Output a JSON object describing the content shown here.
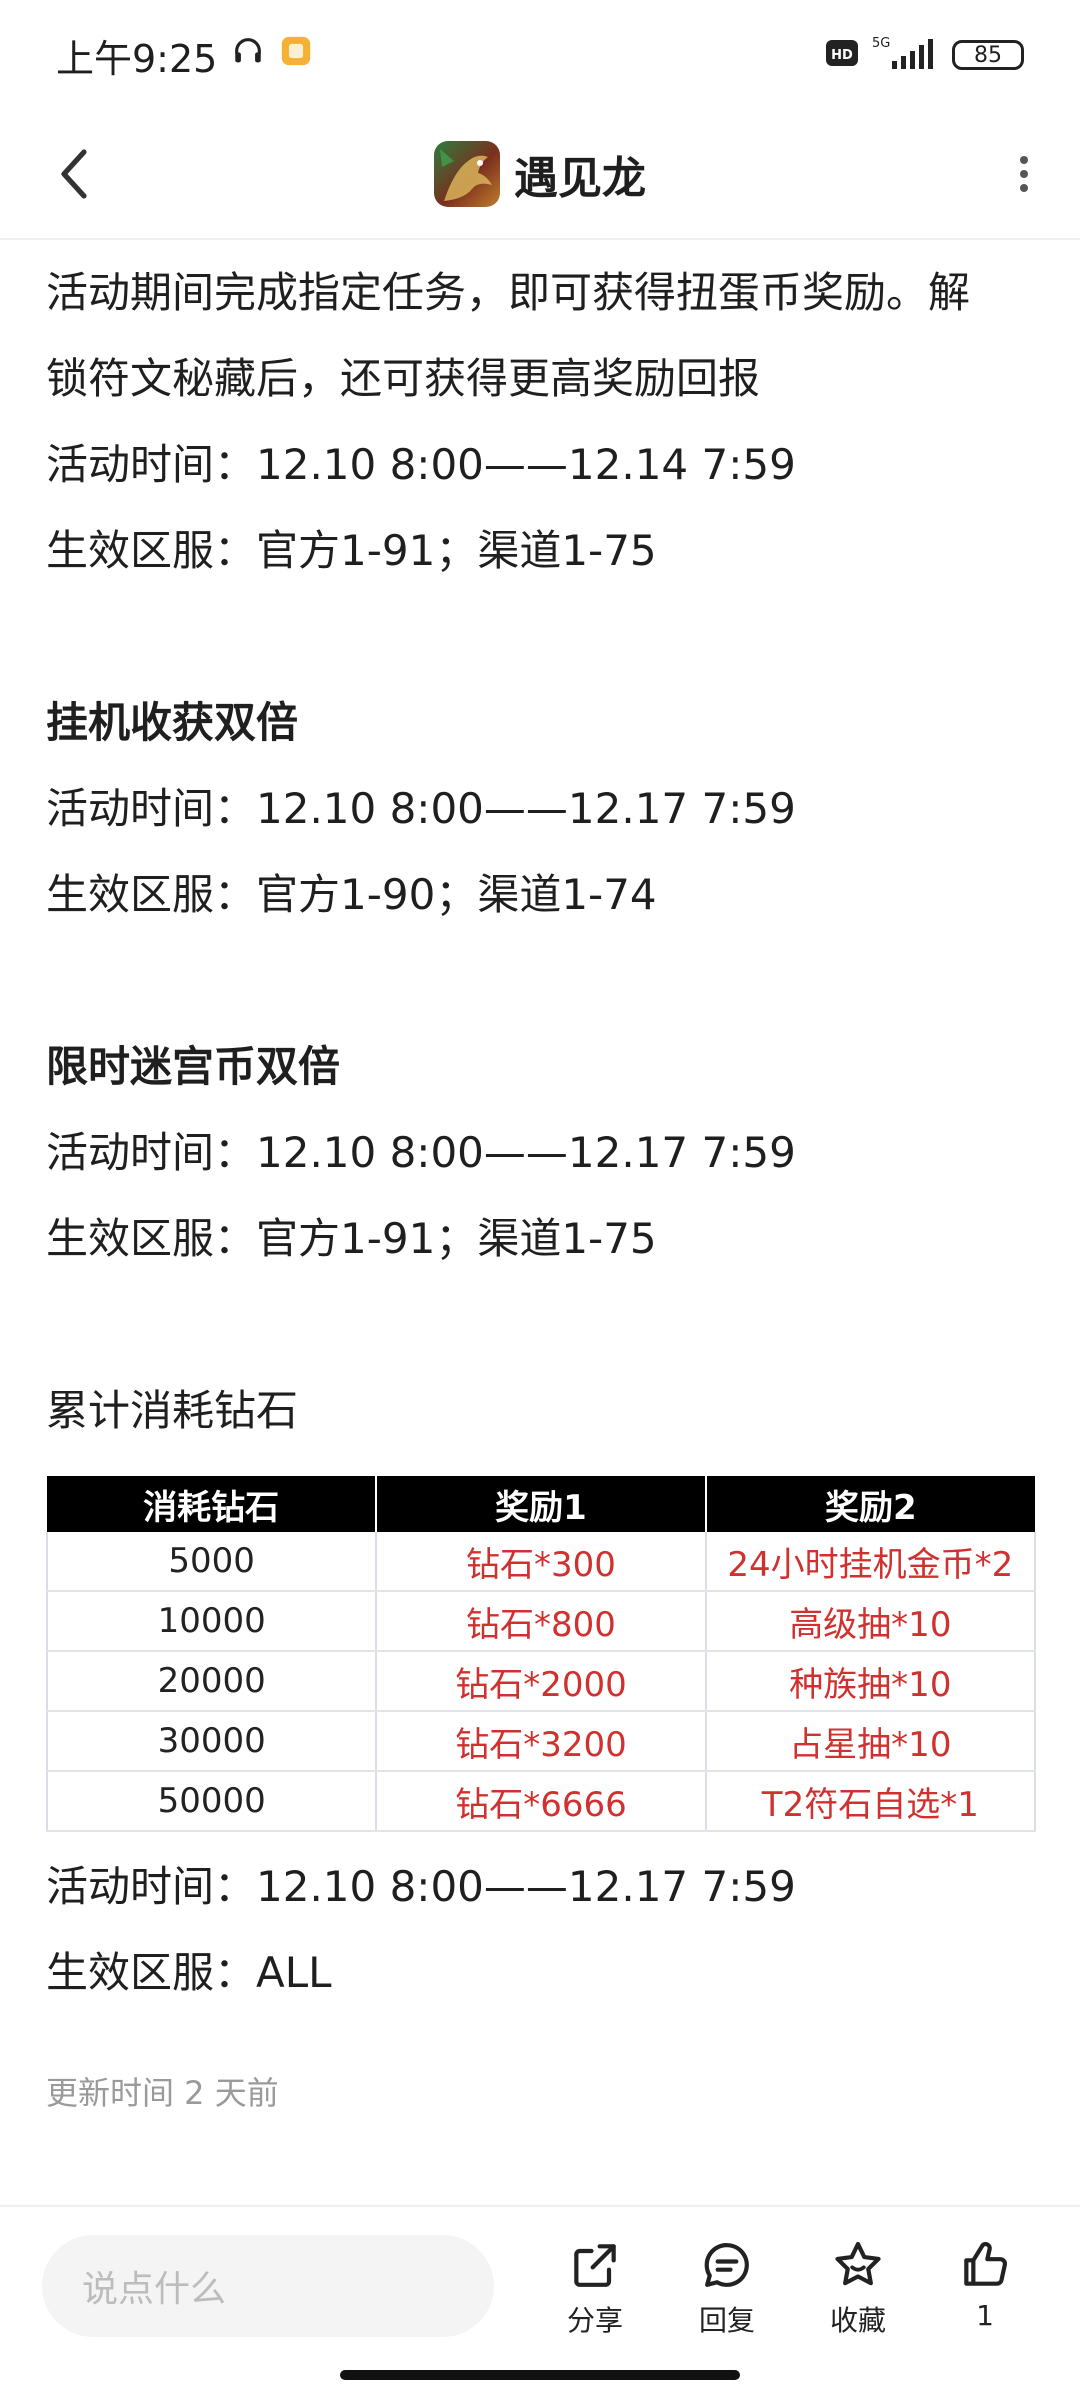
{
  "status": {
    "time": "上午9:25",
    "network": "5G",
    "battery": "85"
  },
  "header": {
    "title": "遇见龙"
  },
  "article": {
    "intro_line1": "活动期间完成指定任务，即可获得扭蛋币奖励。解",
    "intro_line2": "锁符文秘藏后，还可获得更高奖励回报",
    "intro_time": "活动时间：12.10 8:00——12.14 7:59",
    "intro_servers": "生效区服：官方1-91；渠道1-75",
    "sections": [
      {
        "title": "挂机收获双倍",
        "time": "活动时间：12.10 8:00——12.17 7:59",
        "servers": "生效区服：官方1-90；渠道1-74"
      },
      {
        "title": "限时迷宫币双倍",
        "time": "活动时间：12.10 8:00——12.17 7:59",
        "servers": "生效区服：官方1-91；渠道1-75"
      }
    ],
    "diamond": {
      "title": "累计消耗钻石",
      "headers": [
        "消耗钻石",
        "奖励1",
        "奖励2"
      ],
      "rows": [
        [
          "5000",
          "钻石*300",
          "24小时挂机金币*2"
        ],
        [
          "10000",
          "钻石*800",
          "高级抽*10"
        ],
        [
          "20000",
          "钻石*2000",
          "种族抽*10"
        ],
        [
          "30000",
          "钻石*3200",
          "占星抽*10"
        ],
        [
          "50000",
          "钻石*6666",
          "T2符石自选*1"
        ]
      ],
      "time": "活动时间：12.10 8:00——12.17 7:59",
      "servers": "生效区服：ALL"
    },
    "updated": "更新时间 2 天前"
  },
  "bottom": {
    "comment_placeholder": "说点什么",
    "share_label": "分享",
    "reply_label": "回复",
    "favorite_label": "收藏",
    "like_count": "1"
  }
}
